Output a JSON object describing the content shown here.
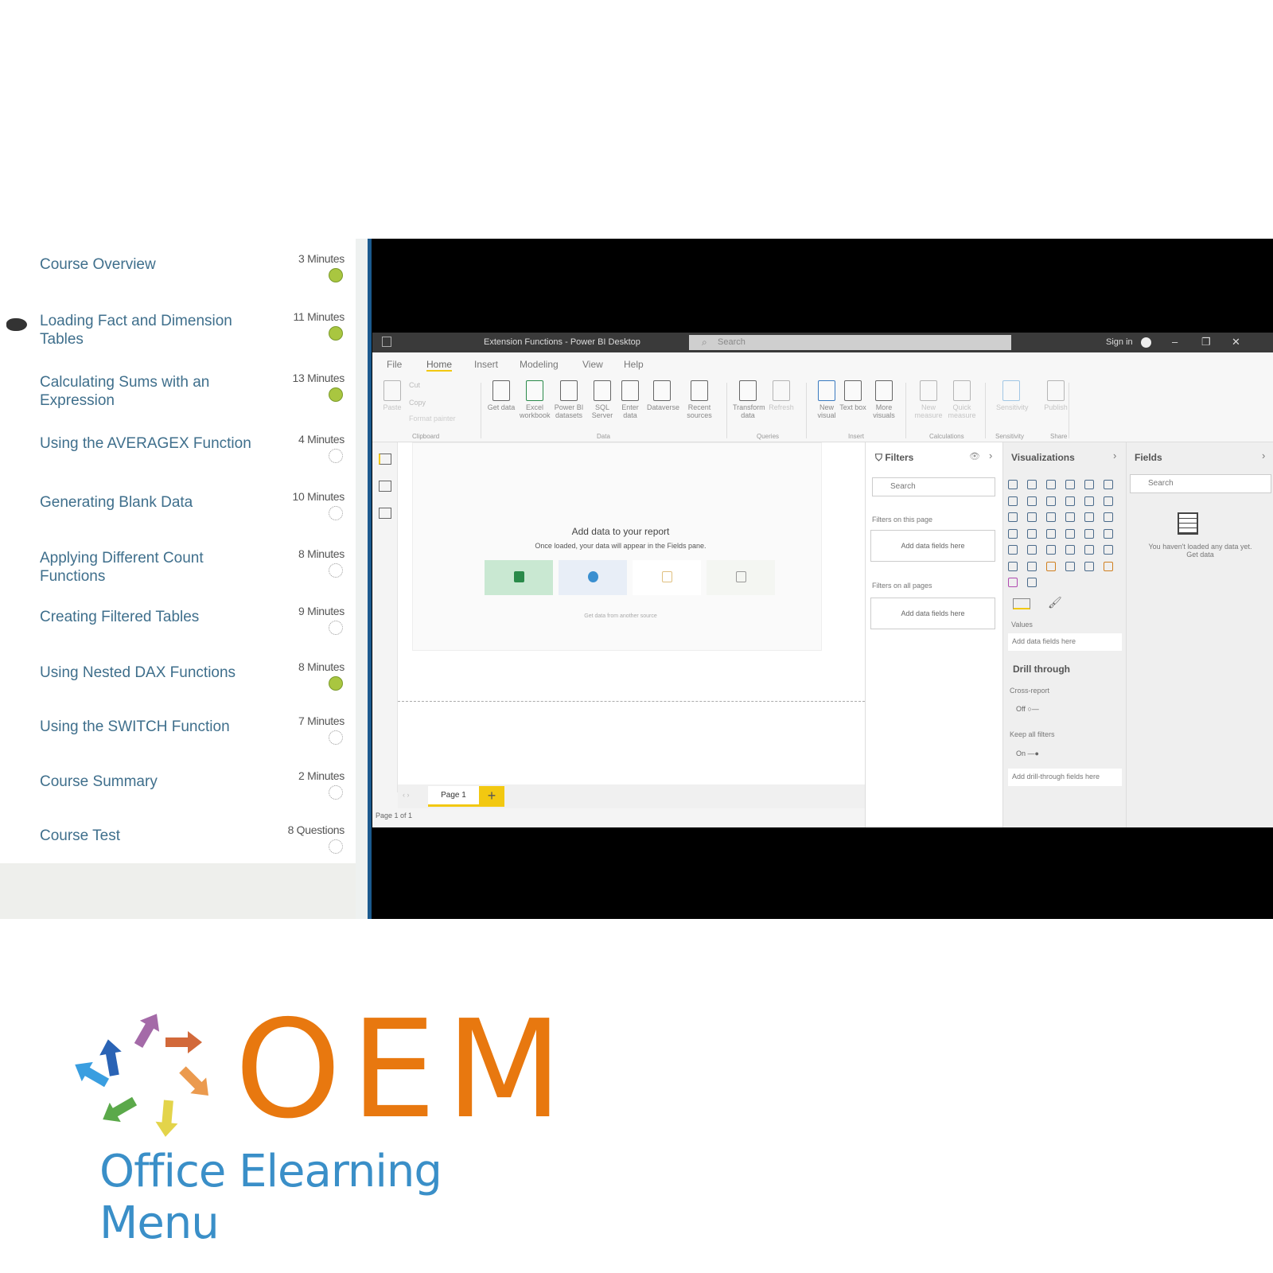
{
  "course": {
    "items": [
      {
        "title": "Course Overview",
        "duration": "3 Minutes",
        "status": "completed"
      },
      {
        "title": "Loading Fact and Dimension Tables",
        "duration": "11 Minutes",
        "status": "completed",
        "current": true
      },
      {
        "title": "Calculating Sums with an Expression",
        "duration": "13 Minutes",
        "status": "completed"
      },
      {
        "title": "Using the AVERAGEX Function",
        "duration": "4 Minutes",
        "status": "not-started"
      },
      {
        "title": "Generating Blank Data",
        "duration": "10 Minutes",
        "status": "not-started"
      },
      {
        "title": "Applying Different Count Functions",
        "duration": "8 Minutes",
        "status": "not-started"
      },
      {
        "title": "Creating Filtered Tables",
        "duration": "9 Minutes",
        "status": "not-started"
      },
      {
        "title": "Using Nested DAX Functions",
        "duration": "8 Minutes",
        "status": "completed"
      },
      {
        "title": "Using the SWITCH Function",
        "duration": "7 Minutes",
        "status": "not-started"
      },
      {
        "title": "Course Summary",
        "duration": "2 Minutes",
        "status": "not-started"
      },
      {
        "title": "Course Test",
        "duration": "8 Questions",
        "status": "not-started"
      }
    ]
  },
  "powerbi": {
    "window_title": "Extension Functions - Power BI Desktop",
    "search_placeholder": "Search",
    "sign_in": "Sign in",
    "tabs": [
      "File",
      "Home",
      "Insert",
      "Modeling",
      "View",
      "Help"
    ],
    "active_tab": "Home",
    "ribbon": {
      "clipboard": {
        "paste": "Paste",
        "cut": "Cut",
        "copy": "Copy",
        "format_painter": "Format painter",
        "group": "Clipboard"
      },
      "data": {
        "buttons": [
          "Get data",
          "Excel workbook",
          "Power BI datasets",
          "SQL Server",
          "Enter data",
          "Dataverse",
          "Recent sources"
        ],
        "group": "Data"
      },
      "queries": {
        "buttons": [
          "Transform data",
          "Refresh"
        ],
        "group": "Queries"
      },
      "insert": {
        "buttons": [
          "New visual",
          "Text box",
          "More visuals"
        ],
        "group": "Insert"
      },
      "calculations": {
        "buttons": [
          "New measure",
          "Quick measure"
        ],
        "group": "Calculations"
      },
      "sensitivity": {
        "buttons": [
          "Sensitivity"
        ],
        "group": "Sensitivity"
      },
      "share": {
        "buttons": [
          "Publish"
        ],
        "group": "Share"
      }
    },
    "canvas": {
      "add_data_title": "Add data to your report",
      "add_data_sub": "Once loaded, your data will appear in the Fields pane.",
      "get_data_other": "Get data from another source"
    },
    "page_tab": "Page 1",
    "add_page": "+",
    "status": "Page 1 of 1",
    "filters": {
      "title": "Filters",
      "search": "Search",
      "this_page": "Filters on this page",
      "all_pages": "Filters on all pages",
      "drop": "Add data fields here"
    },
    "visualizations": {
      "title": "Visualizations",
      "values_label": "Values",
      "values_drop": "Add data fields here",
      "drill_through": "Drill through",
      "cross_report": "Cross-report",
      "cross_report_state": "Off",
      "keep_filters": "Keep all filters",
      "keep_filters_state": "On",
      "drill_drop": "Add drill-through fields here"
    },
    "fields": {
      "title": "Fields",
      "search": "Search",
      "empty": "You haven't loaded any data yet. Get data"
    },
    "accent": "#f2c811"
  },
  "logo": {
    "mark": "OEM",
    "name": "Office Elearning Menu",
    "colors": {
      "mark": "#e8780f",
      "name": "#3a8fc8"
    }
  }
}
